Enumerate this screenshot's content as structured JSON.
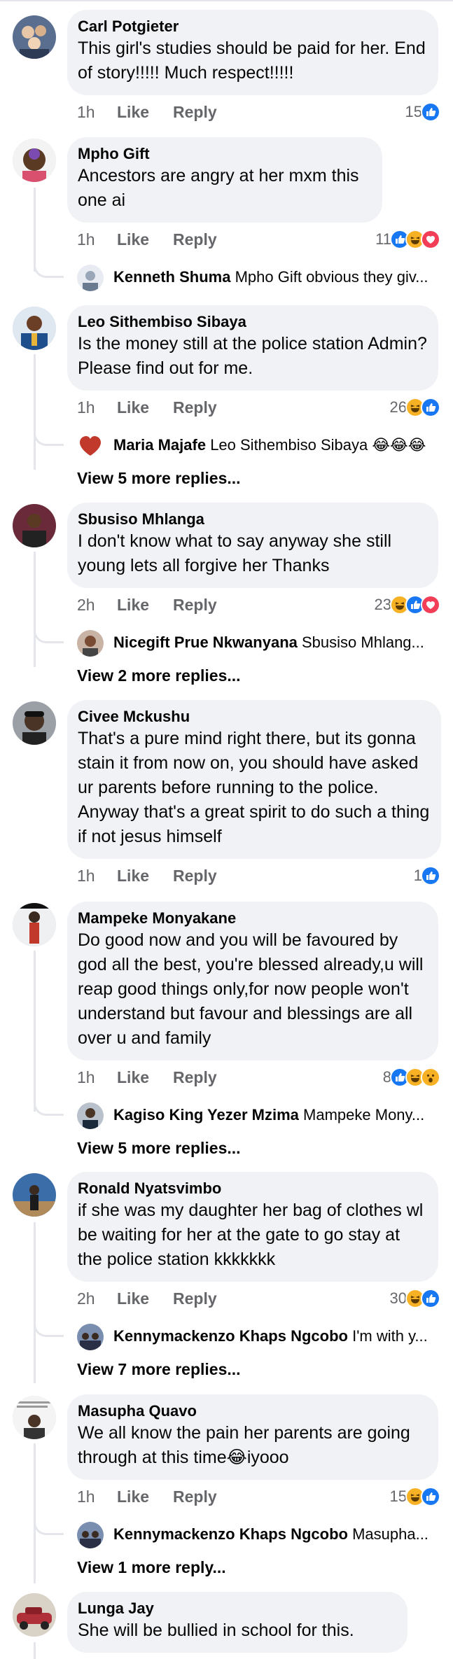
{
  "colors": {
    "like_blue": "#1877f2",
    "love_red": "#f33e58",
    "haha_yellow": "#f7b125",
    "text_grey": "#65676b",
    "bubble": "#f0f2f5"
  },
  "comments": [
    {
      "author": "Carl Potgieter",
      "text": "This girl's studies should be paid for her. End of story!!!!! Much respect!!!!!",
      "time": "1h",
      "like": "Like",
      "reply": "Reply",
      "reactions": "15",
      "reaction_icons": [
        "like-icon"
      ]
    },
    {
      "author": "Mpho Gift",
      "text": "Ancestors are angry at her mxm this one ai",
      "time": "1h",
      "like": "Like",
      "reply": "Reply",
      "reactions": "11",
      "reaction_icons": [
        "like-icon",
        "haha-icon",
        "love-icon"
      ],
      "reply_preview": {
        "name": "Kenneth Shuma",
        "text": "Mpho Gift obvious they giv..."
      }
    },
    {
      "author": "Leo Sithembiso Sibaya",
      "text": "Is the money still at the police station Admin? Please find out for me.",
      "time": "1h",
      "like": "Like",
      "reply": "Reply",
      "reactions": "26",
      "reaction_icons": [
        "haha-icon",
        "like-icon"
      ],
      "reply_preview": {
        "name": "Maria Majafe",
        "text": "Leo Sithembiso Sibaya 😂😂😂"
      },
      "more": "View 5 more replies..."
    },
    {
      "author": "Sbusiso Mhlanga",
      "text": "I don't know what to say anyway she still young lets all forgive her Thanks",
      "time": "2h",
      "like": "Like",
      "reply": "Reply",
      "reactions": "23",
      "reaction_icons": [
        "haha-icon",
        "like-icon",
        "love-icon"
      ],
      "reply_preview": {
        "name": "Nicegift Prue Nkwanyana",
        "text": "Sbusiso Mhlang..."
      },
      "more": "View 2 more replies..."
    },
    {
      "author": "Civee Mckushu",
      "text": "That's a pure mind right there, but its gonna stain it from now on, you should have asked ur parents before running to the police.  Anyway that's a great spirit to do such a thing if not jesus himself",
      "time": "1h",
      "like": "Like",
      "reply": "Reply",
      "reactions": "1",
      "reaction_icons": [
        "like-icon"
      ]
    },
    {
      "author": "Mampeke Monyakane",
      "text": "Do good now and you will be favoured by god all the best, you're blessed already,u will reap good things only,for now people won't understand but favour and blessings are all over u and family",
      "time": "1h",
      "like": "Like",
      "reply": "Reply",
      "reactions": "8",
      "reaction_icons": [
        "like-icon",
        "haha-icon",
        "wow-icon"
      ],
      "reply_preview": {
        "name": "Kagiso King Yezer Mzima",
        "text": "Mampeke Mony..."
      },
      "more": "View 5 more replies..."
    },
    {
      "author": "Ronald Nyatsvimbo",
      "text": "if she was my daughter her bag of clothes wl be waiting for her at the gate to go stay at the police station kkkkkkk",
      "time": "2h",
      "like": "Like",
      "reply": "Reply",
      "reactions": "30",
      "reaction_icons": [
        "haha-icon",
        "like-icon"
      ],
      "reply_preview": {
        "name": "Kennymackenzo Khaps Ngcobo",
        "text": "I'm with y..."
      },
      "more": "View 7 more replies..."
    },
    {
      "author": "Masupha Quavo",
      "text": "We all know the pain her parents are going through at this time😂iyooo",
      "time": "1h",
      "like": "Like",
      "reply": "Reply",
      "reactions": "15",
      "reaction_icons": [
        "haha-icon",
        "like-icon"
      ],
      "reply_preview": {
        "name": "Kennymackenzo Khaps Ngcobo",
        "text": "Masupha..."
      },
      "more": "View 1 more reply..."
    },
    {
      "author": "Lunga Jay",
      "text": "She will be bullied in school for this."
    }
  ]
}
